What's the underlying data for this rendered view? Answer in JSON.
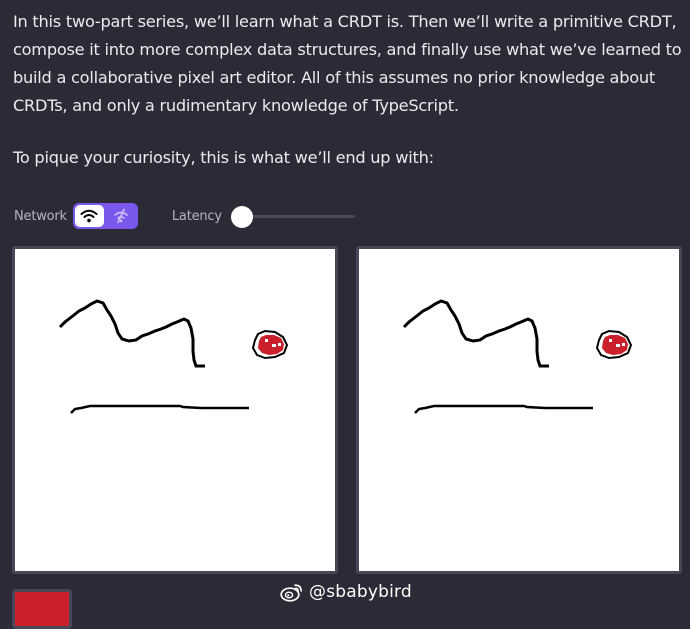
{
  "intro": {
    "paragraph": "In this two-part series, we’ll learn what a CRDT is. Then we’ll write a primitive CRDT, compose it into more complex data structures, and finally use what we’ve learned to build a collaborative pixel art editor. All of this assumes no prior knowledge about CRDTs, and only a rudimentary knowledge of TypeScript.",
    "pique": "To pique your curiosity, this is what we’ll end up with:"
  },
  "controls": {
    "network_label": "Network",
    "network_options": [
      {
        "icon": "wifi-icon",
        "selected": true
      },
      {
        "icon": "wifi-off-icon",
        "selected": false
      }
    ],
    "latency_label": "Latency",
    "latency_value": 0
  },
  "canvases": {
    "background": "#ffffff",
    "stroke_color": "#000000",
    "accent_color": "#c9202b",
    "border_color": "#4a4658"
  },
  "palette": {
    "selected_color": "#c9202b"
  },
  "watermark": {
    "text": "@sbabybird",
    "icon": "weibo-icon"
  }
}
